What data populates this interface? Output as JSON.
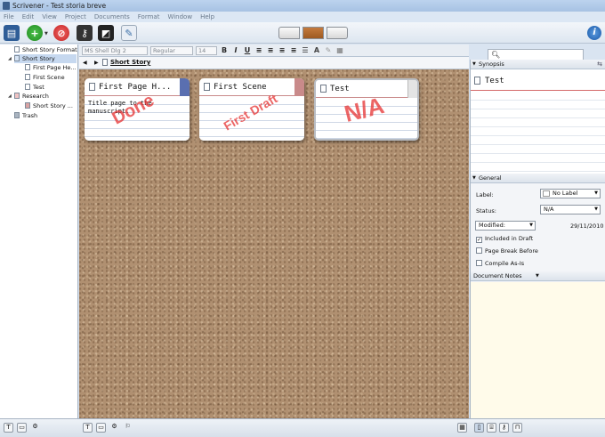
{
  "window": {
    "title": "Scrivener - Test storia breve"
  },
  "menu": [
    "File",
    "Edit",
    "View",
    "Project",
    "Documents",
    "Format",
    "Window",
    "Help"
  ],
  "format": {
    "font": "MS Shell Dlg 2",
    "style": "Regular",
    "size": "14",
    "bold": "B",
    "italic": "I",
    "underline": "U"
  },
  "nav": {
    "path": "Short Story"
  },
  "binder": {
    "items": [
      {
        "label": "Short Story Format"
      },
      {
        "label": "Short Story"
      },
      {
        "label": "First Page He..."
      },
      {
        "label": "First Scene"
      },
      {
        "label": "Test"
      },
      {
        "label": "Research"
      },
      {
        "label": "Short Story ..."
      },
      {
        "label": "Trash"
      }
    ]
  },
  "cards": [
    {
      "title": "First Page H...",
      "synopsis": "Title page to the manuscript.",
      "stamp": "Done",
      "label_color": "#5a6fb0"
    },
    {
      "title": "First Scene",
      "synopsis": "",
      "stamp": "First Draft",
      "label_color": "#c98a8a"
    },
    {
      "title": "Test",
      "synopsis": "",
      "stamp": "N/A",
      "label_color": "#d0d0d0"
    }
  ],
  "inspector": {
    "synopsis_header": "Synopsis",
    "synopsis_title": "Test",
    "general_header": "General",
    "label_caption": "Label:",
    "label_value": "No Label",
    "status_caption": "Status:",
    "status_value": "N/A",
    "modified_caption": "Modified:",
    "modified_date": "29/11/2010",
    "included_in_draft": "Included in Draft",
    "page_break_before": "Page Break Before",
    "compile_as_is": "Compile As-Is",
    "notes_header": "Document Notes"
  },
  "colors": {
    "accent": "#3b6fb5",
    "stamp": "#e63232"
  }
}
